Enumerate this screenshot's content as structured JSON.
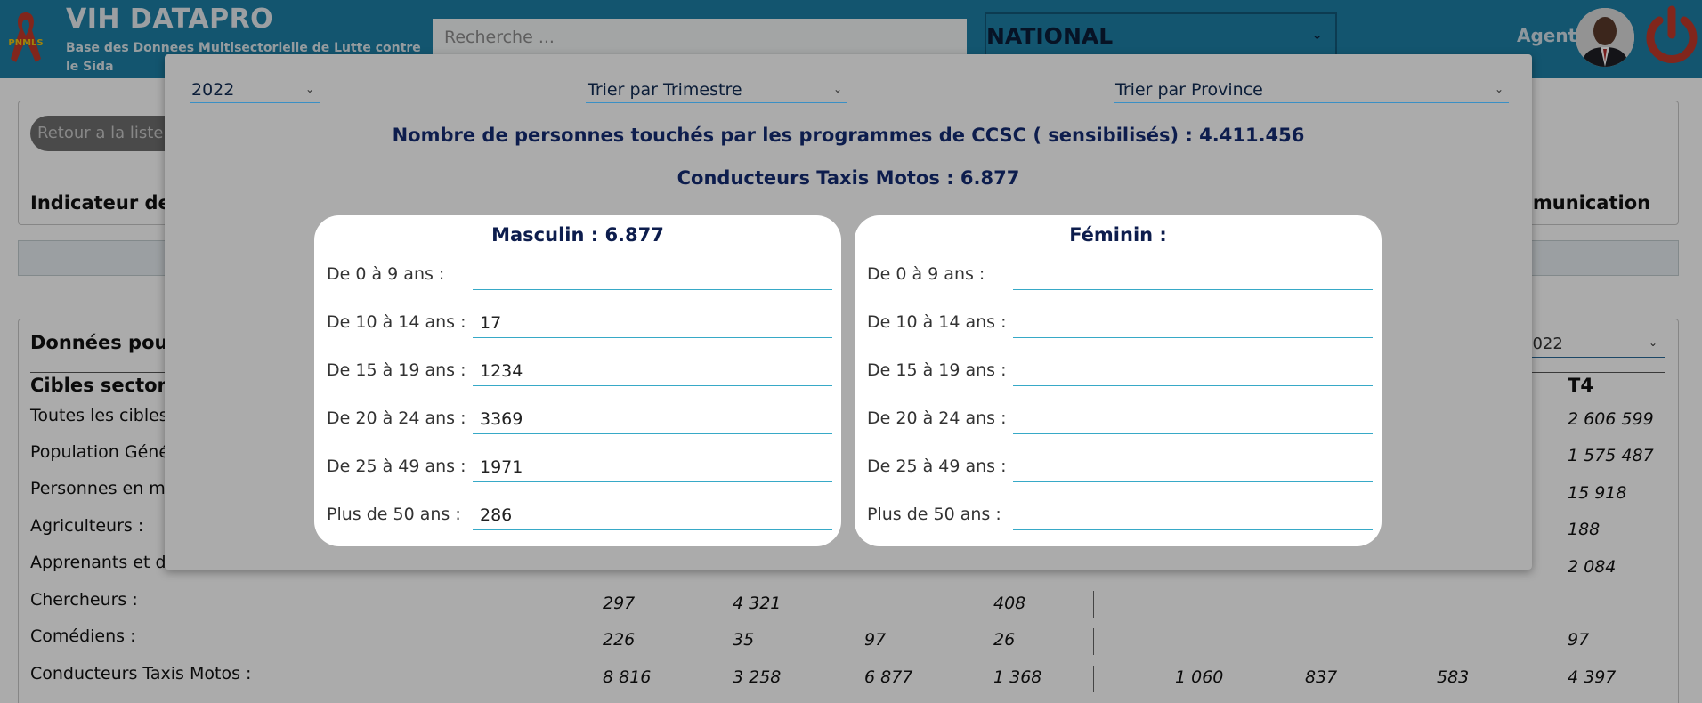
{
  "header": {
    "logo_text": "PNMLS",
    "app_title": "VIH DATAPRO",
    "app_subtitle": "Base des Donnees Multisectorielle de Lutte contre le Sida",
    "search_placeholder": "Recherche ...",
    "scope": "NATIONAL",
    "agent_label": "Agent",
    "colors": {
      "bar": "#1d7fa6",
      "power": "#c0392b"
    }
  },
  "background_page": {
    "back_button": "Retour a la liste",
    "indicator_title_left": "Indicateur de",
    "indicator_title_right": "mmunication",
    "donnees_title": "Données pou",
    "year_select": "2022",
    "cibles_header": "Cibles sectori",
    "t4_header": "T4",
    "rows": [
      {
        "label": "Toutes les cibles",
        "values": [],
        "t4": "2 606 599"
      },
      {
        "label": "Population Géné",
        "values": [],
        "t4": "1 575 487"
      },
      {
        "label": "Personnes en m",
        "values": [],
        "t4": "15 918"
      },
      {
        "label": "Agriculteurs :",
        "values": [],
        "t4": "188"
      },
      {
        "label": "Apprenants et d",
        "values": [],
        "t4": "2 084"
      },
      {
        "label": "Chercheurs :",
        "values": [
          "297",
          "4 321",
          "",
          "408"
        ],
        "t4": ""
      },
      {
        "label": "Comédiens :",
        "values": [
          "226",
          "35",
          "97",
          "26"
        ],
        "t4": "97"
      },
      {
        "label": "Conducteurs Taxis Motos :",
        "values": [
          "8 816",
          "3 258",
          "6 877",
          "1 368"
        ],
        "right": [
          "1 060",
          "837",
          "583"
        ],
        "t4": "4 397"
      }
    ]
  },
  "modal": {
    "year": "2022",
    "trimestre_select": "Trier par Trimestre",
    "province_select": "Trier par Province",
    "heading_main": "Nombre de personnes touchés par les programmes de CCSC  ( sensibilisés) : 4.411.456",
    "heading_sub": "Conducteurs Taxis Motos : 6.877",
    "masculin": {
      "title": "Masculin : 6.877",
      "rows": [
        {
          "label": "De 0 à 9 ans :",
          "value": ""
        },
        {
          "label": "De 10 à  14 ans :",
          "value": "17"
        },
        {
          "label": "De 15 à  19 ans :",
          "value": "1234"
        },
        {
          "label": "De 20 à 24 ans :",
          "value": "3369"
        },
        {
          "label": "De 25 à 49 ans :",
          "value": "1971"
        },
        {
          "label": "Plus de 50 ans :",
          "value": "286"
        }
      ]
    },
    "feminin": {
      "title": "Féminin :",
      "rows": [
        {
          "label": "De 0 à 9 ans :",
          "value": ""
        },
        {
          "label": "De 10 à  14 ans :",
          "value": ""
        },
        {
          "label": "De 15 à  19 ans :",
          "value": ""
        },
        {
          "label": "De 20 à 24 ans :",
          "value": ""
        },
        {
          "label": "De 25 à 49 ans :",
          "value": ""
        },
        {
          "label": "Plus de 50 ans :",
          "value": ""
        }
      ]
    }
  }
}
